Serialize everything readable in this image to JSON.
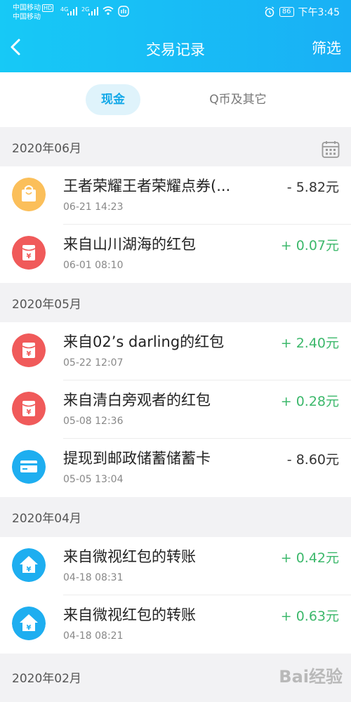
{
  "status_bar": {
    "carrier1": "中国移动",
    "hd": "HD",
    "carrier2": "中国移动",
    "net1": "4G",
    "net2": "2G",
    "battery": "86",
    "time": "下午3:45"
  },
  "header": {
    "title": "交易记录",
    "filter_label": "筛选"
  },
  "tabs": [
    {
      "label": "现金",
      "active": true
    },
    {
      "label": "Q币及其它",
      "active": false
    }
  ],
  "sections": [
    {
      "month": "2020年06月",
      "transactions": [
        {
          "name": "王者荣耀王者荣耀点券(...",
          "date": "06-21 14:23",
          "amount": "- 5.82元",
          "type": "negative",
          "icon": "shopping-bag-icon"
        },
        {
          "name": "来自山川湖海的红包",
          "date": "06-01 08:10",
          "amount": "+ 0.07元",
          "type": "positive",
          "icon": "red-packet-icon"
        }
      ]
    },
    {
      "month": "2020年05月",
      "transactions": [
        {
          "name": "来自02’s darling的红包",
          "date": "05-22 12:07",
          "amount": "+ 2.40元",
          "type": "positive",
          "icon": "red-packet-icon"
        },
        {
          "name": "来自清白旁观者的红包",
          "date": "05-08 12:36",
          "amount": "+ 0.28元",
          "type": "positive",
          "icon": "red-packet-icon"
        },
        {
          "name": "提现到邮政储蓄储蓄卡",
          "date": "05-05 13:04",
          "amount": "- 8.60元",
          "type": "negative",
          "icon": "bank-card-icon"
        }
      ]
    },
    {
      "month": "2020年04月",
      "transactions": [
        {
          "name": "来自微视红包的转账",
          "date": "04-18 08:31",
          "amount": "+ 0.42元",
          "type": "positive",
          "icon": "transfer-icon"
        },
        {
          "name": "来自微视红包的转账",
          "date": "04-18 08:21",
          "amount": "+ 0.63元",
          "type": "positive",
          "icon": "transfer-icon"
        }
      ]
    },
    {
      "month": "2020年02月",
      "transactions": []
    }
  ],
  "watermark": "Bai经验",
  "colors": {
    "header_gradient": [
      "#17c9f6",
      "#19b0f5"
    ],
    "positive": "#3cb86b",
    "red_packet": "#f05a5a",
    "blue_icon": "#1eaef0",
    "bag_icon": "#fbbf5a"
  }
}
